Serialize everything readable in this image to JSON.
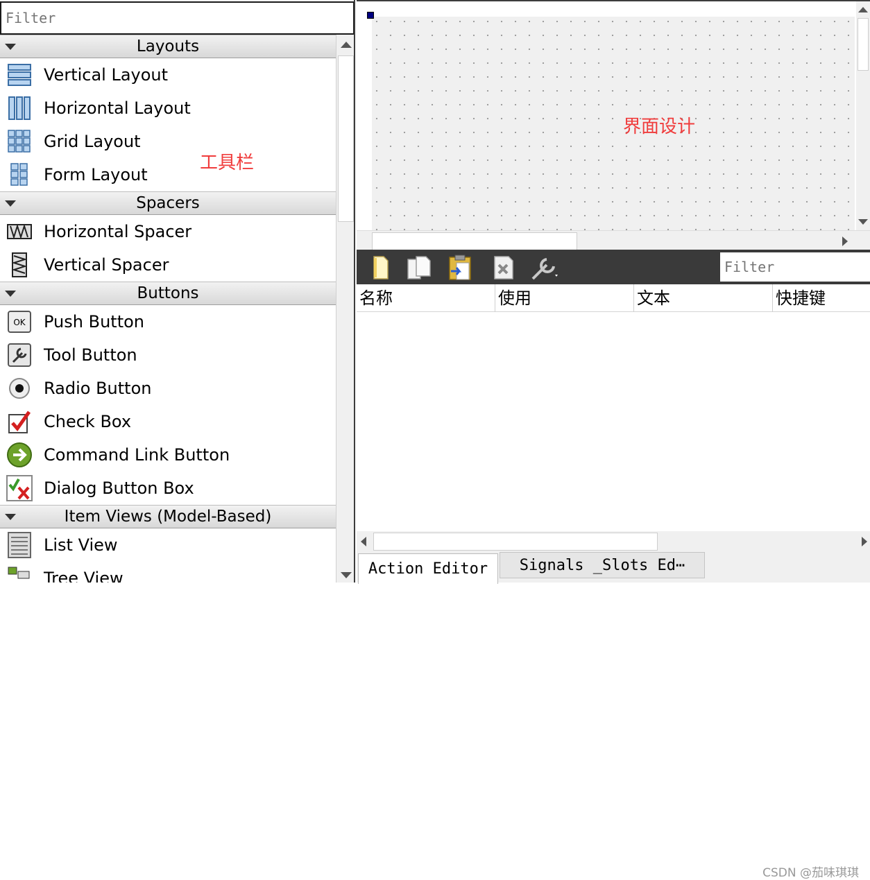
{
  "widget_box": {
    "filter_placeholder": "Filter",
    "categories": [
      {
        "title": "Layouts",
        "items": [
          "Vertical Layout",
          "Horizontal Layout",
          "Grid Layout",
          "Form Layout"
        ]
      },
      {
        "title": "Spacers",
        "items": [
          "Horizontal Spacer",
          "Vertical Spacer"
        ]
      },
      {
        "title": "Buttons",
        "items": [
          "Push Button",
          "Tool Button",
          "Radio Button",
          "Check Box",
          "Command Link Button",
          "Dialog Button Box"
        ]
      },
      {
        "title": "Item Views (Model-Based)",
        "items": [
          "List View",
          "Tree View"
        ]
      }
    ],
    "annotation": "工具栏"
  },
  "design_area": {
    "annotation": "界面设计"
  },
  "action_editor": {
    "filter_placeholder": "Filter",
    "toolbar_icons": [
      "new-action-icon",
      "copy-action-icon",
      "paste-action-icon",
      "delete-action-icon",
      "configure-wrench-icon"
    ],
    "columns": [
      "名称",
      "使用",
      "文本",
      "快捷键"
    ],
    "tabs": [
      "Action Editor",
      "Signals _Slots Ed⋯"
    ]
  },
  "watermark": "CSDN @茄味琪琪",
  "colors": {
    "annotation": "#f03c3c",
    "dark_toolbar": "#3a3a3a"
  }
}
